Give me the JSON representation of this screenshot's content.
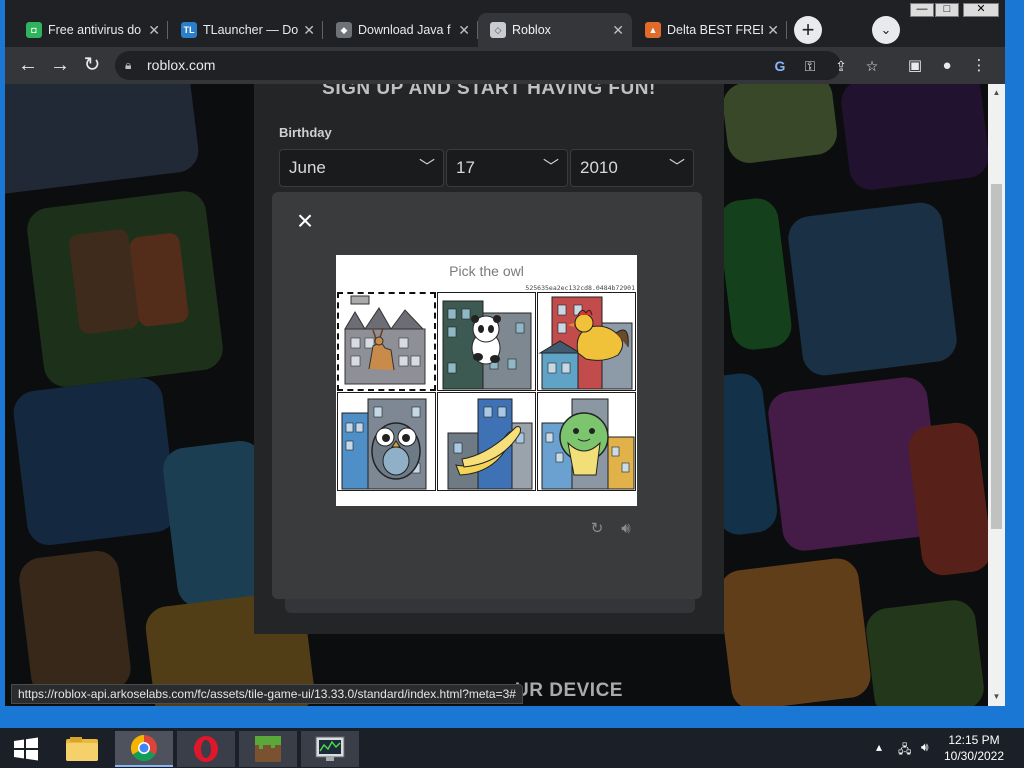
{
  "browser": {
    "tabs": [
      {
        "title": "Free antivirus do",
        "favicon": "antivirus-favicon",
        "color": "#2fb35c"
      },
      {
        "title": "TLauncher — Do",
        "favicon": "tlauncher-favicon",
        "color": "#2a7fc8"
      },
      {
        "title": "Download Java f",
        "favicon": "java-favicon",
        "color": "#6f7276"
      },
      {
        "title": "Roblox",
        "favicon": "roblox-favicon",
        "color": "#c9cdd1"
      },
      {
        "title": "Delta BEST FREE",
        "favicon": "delta-favicon",
        "color": "#e06b2b"
      }
    ],
    "active_tab": 3,
    "address": "roblox.com",
    "new_tab_label": "+",
    "window_controls": [
      "—",
      "□",
      "✕"
    ]
  },
  "signup": {
    "title": "SIGN UP AND START HAVING FUN!",
    "birthday_label": "Birthday",
    "birthday": {
      "month": "June",
      "day": "17",
      "year": "2010"
    },
    "footer_text": "UR DEVICE"
  },
  "captcha": {
    "prompt": "Pick the owl",
    "token": "525635ea2ec132cd8.0484b72901",
    "tiles": [
      {
        "animal": "deer",
        "selected": true
      },
      {
        "animal": "panda",
        "selected": false
      },
      {
        "animal": "rooster",
        "selected": false
      },
      {
        "animal": "owl",
        "selected": false
      },
      {
        "animal": "banana",
        "selected": false
      },
      {
        "animal": "turtle",
        "selected": false
      }
    ],
    "close_label": "×"
  },
  "status_url": "https://roblox-api.arkoselabs.com/fc/assets/tile-game-ui/13.33.0/standard/index.html?meta=3#",
  "taskbar": {
    "apps": [
      "start",
      "file-explorer",
      "chrome",
      "opera",
      "minecraft",
      "system-monitor"
    ],
    "time": "12:15 PM",
    "date": "10/30/2022"
  }
}
